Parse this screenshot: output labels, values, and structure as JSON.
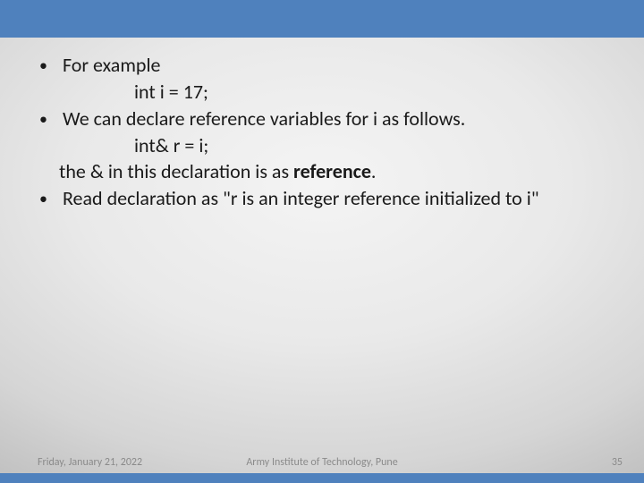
{
  "bullets": {
    "b1": "For example",
    "b1_code": "int i = 17;",
    "b2": "We can declare reference variables for i as follows.",
    "b2_code": "int& r = i;",
    "b2_expl_pre": "the & in this declaration is as ",
    "b2_expl_bold": "reference",
    "b2_expl_post": ".",
    "b3": "Read declaration as \"r is an integer reference initialized to i\""
  },
  "footer": {
    "date": "Friday, January 21, 2022",
    "institution": "Army Institute of Technology, Pune",
    "page": "35"
  }
}
